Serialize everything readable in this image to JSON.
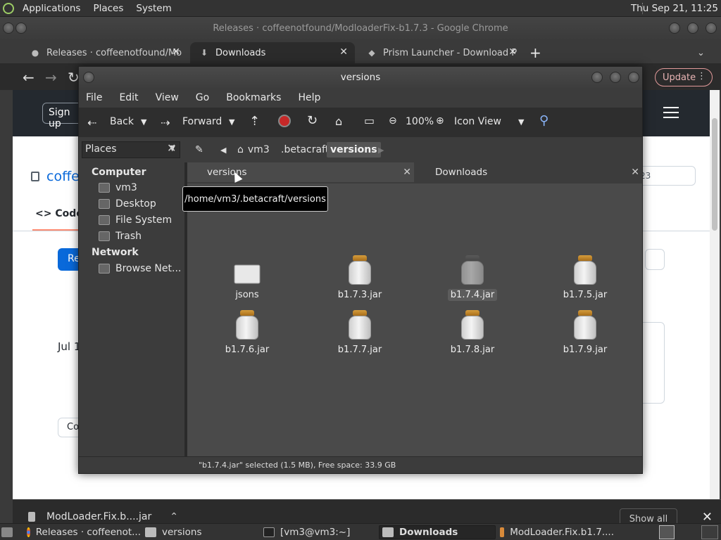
{
  "top_panel": {
    "menus": [
      "Applications",
      "Places",
      "System"
    ],
    "clock": "Thu Sep 21, 11:25"
  },
  "chrome": {
    "window_title": "Releases · coffeenotfound/ModloaderFix-b1.7.3 - Google Chrome",
    "tabs": [
      {
        "label": "Releases · coffeenotfound/Mo",
        "icon": "github-icon"
      },
      {
        "label": "Downloads",
        "icon": "download-icon"
      },
      {
        "label": "Prism Launcher - Download P",
        "icon": "prism-icon"
      }
    ],
    "update_label": "Update",
    "page": {
      "signup": "Sign up",
      "repo": "coffe",
      "code_tab": "Code",
      "release_btn": "Re",
      "date": "Jul 1",
      "compare": "Co",
      "star_count": "23"
    },
    "downloads_shelf": {
      "file": "ModLoader.Fix.b....jar",
      "show_all": "Show all"
    }
  },
  "file_manager": {
    "title": "versions",
    "menus": [
      "File",
      "Edit",
      "View",
      "Go",
      "Bookmarks",
      "Help"
    ],
    "toolbar": {
      "back": "Back",
      "forward": "Forward",
      "zoom": "100%",
      "view_mode": "Icon View"
    },
    "sidebar_combo": "Places",
    "breadcrumbs": [
      "vm3",
      ".betacraft",
      "versions"
    ],
    "sidebar": {
      "computer_header": "Computer",
      "computer_items": [
        "vm3",
        "Desktop",
        "File System",
        "Trash"
      ],
      "network_header": "Network",
      "network_items": [
        "Browse Net..."
      ]
    },
    "tabs": [
      "versions",
      "Downloads"
    ],
    "tooltip": "/home/vm3/.betacraft/versions",
    "files": [
      {
        "name": "jsons",
        "kind": "folder"
      },
      {
        "name": "b1.7.3.jar",
        "kind": "jar"
      },
      {
        "name": "b1.7.4.jar",
        "kind": "jar",
        "selected": true
      },
      {
        "name": "b1.7.5.jar",
        "kind": "jar"
      },
      {
        "name": "b1.7.6.jar",
        "kind": "jar"
      },
      {
        "name": "b1.7.7.jar",
        "kind": "jar"
      },
      {
        "name": "b1.7.8.jar",
        "kind": "jar"
      },
      {
        "name": "b1.7.9.jar",
        "kind": "jar"
      }
    ],
    "status": "\"b1.7.4.jar\" selected (1.5 MB), Free space: 33.9 GB"
  },
  "taskbar": {
    "items": [
      {
        "label": "Releases · coffeenot...",
        "icon": "chrome-icon"
      },
      {
        "label": "versions",
        "icon": "folder-icon"
      },
      {
        "label": "[vm3@vm3:~]",
        "icon": "terminal-icon"
      },
      {
        "label": "Downloads",
        "icon": "folder-icon",
        "active": true
      },
      {
        "label": "ModLoader.Fix.b1.7....",
        "icon": "java-icon"
      }
    ]
  }
}
